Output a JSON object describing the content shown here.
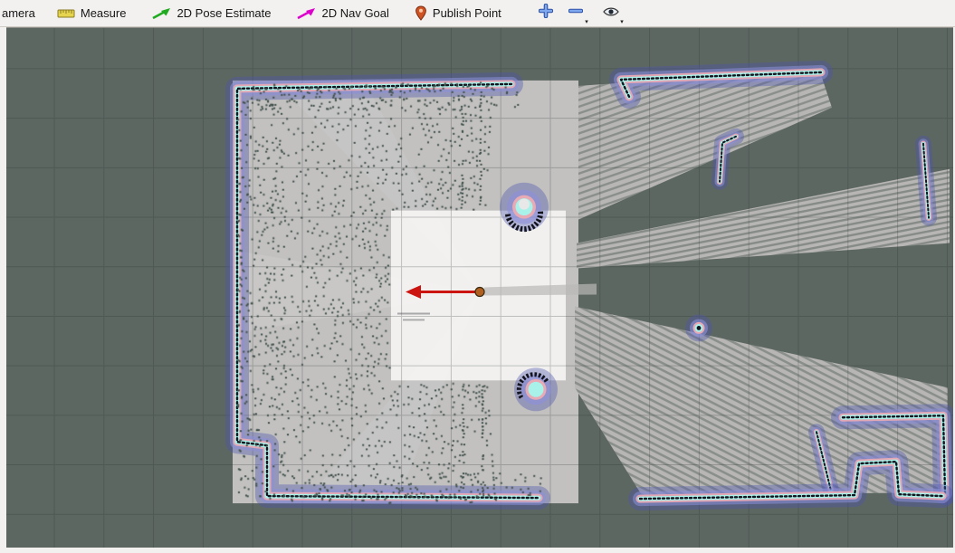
{
  "toolbar": {
    "tools": [
      {
        "id": "move-camera",
        "label": "amera"
      },
      {
        "id": "measure",
        "label": "Measure"
      },
      {
        "id": "pose-estimate",
        "label": "2D Pose Estimate"
      },
      {
        "id": "nav-goal",
        "label": "2D Nav Goal"
      },
      {
        "id": "publish-point",
        "label": "Publish Point"
      }
    ],
    "icon_colors": {
      "measure": "#e6d44e",
      "pose_estimate": "#1faa1f",
      "nav_goal": "#dd00cc",
      "publish_point": "#cf5323",
      "add": "#4a78d8",
      "remove": "#4a78d8",
      "visibility": "#333333"
    }
  },
  "viewport": {
    "colors": {
      "background": "#5d6762",
      "free_space": "#c2c1c0",
      "clear_zone": "#f1f0ef",
      "inflation_outer": "#4d53ae",
      "inflation_mid": "#8c90d8",
      "obstacle_pink": "#e8aab4",
      "obstacle_cyan": "#a8f2ea",
      "obstacle_dark": "#14141f",
      "scan_dots": "#3f4f49",
      "pose_arrow": "#cc1410",
      "robot_marker": "#b06020"
    }
  }
}
